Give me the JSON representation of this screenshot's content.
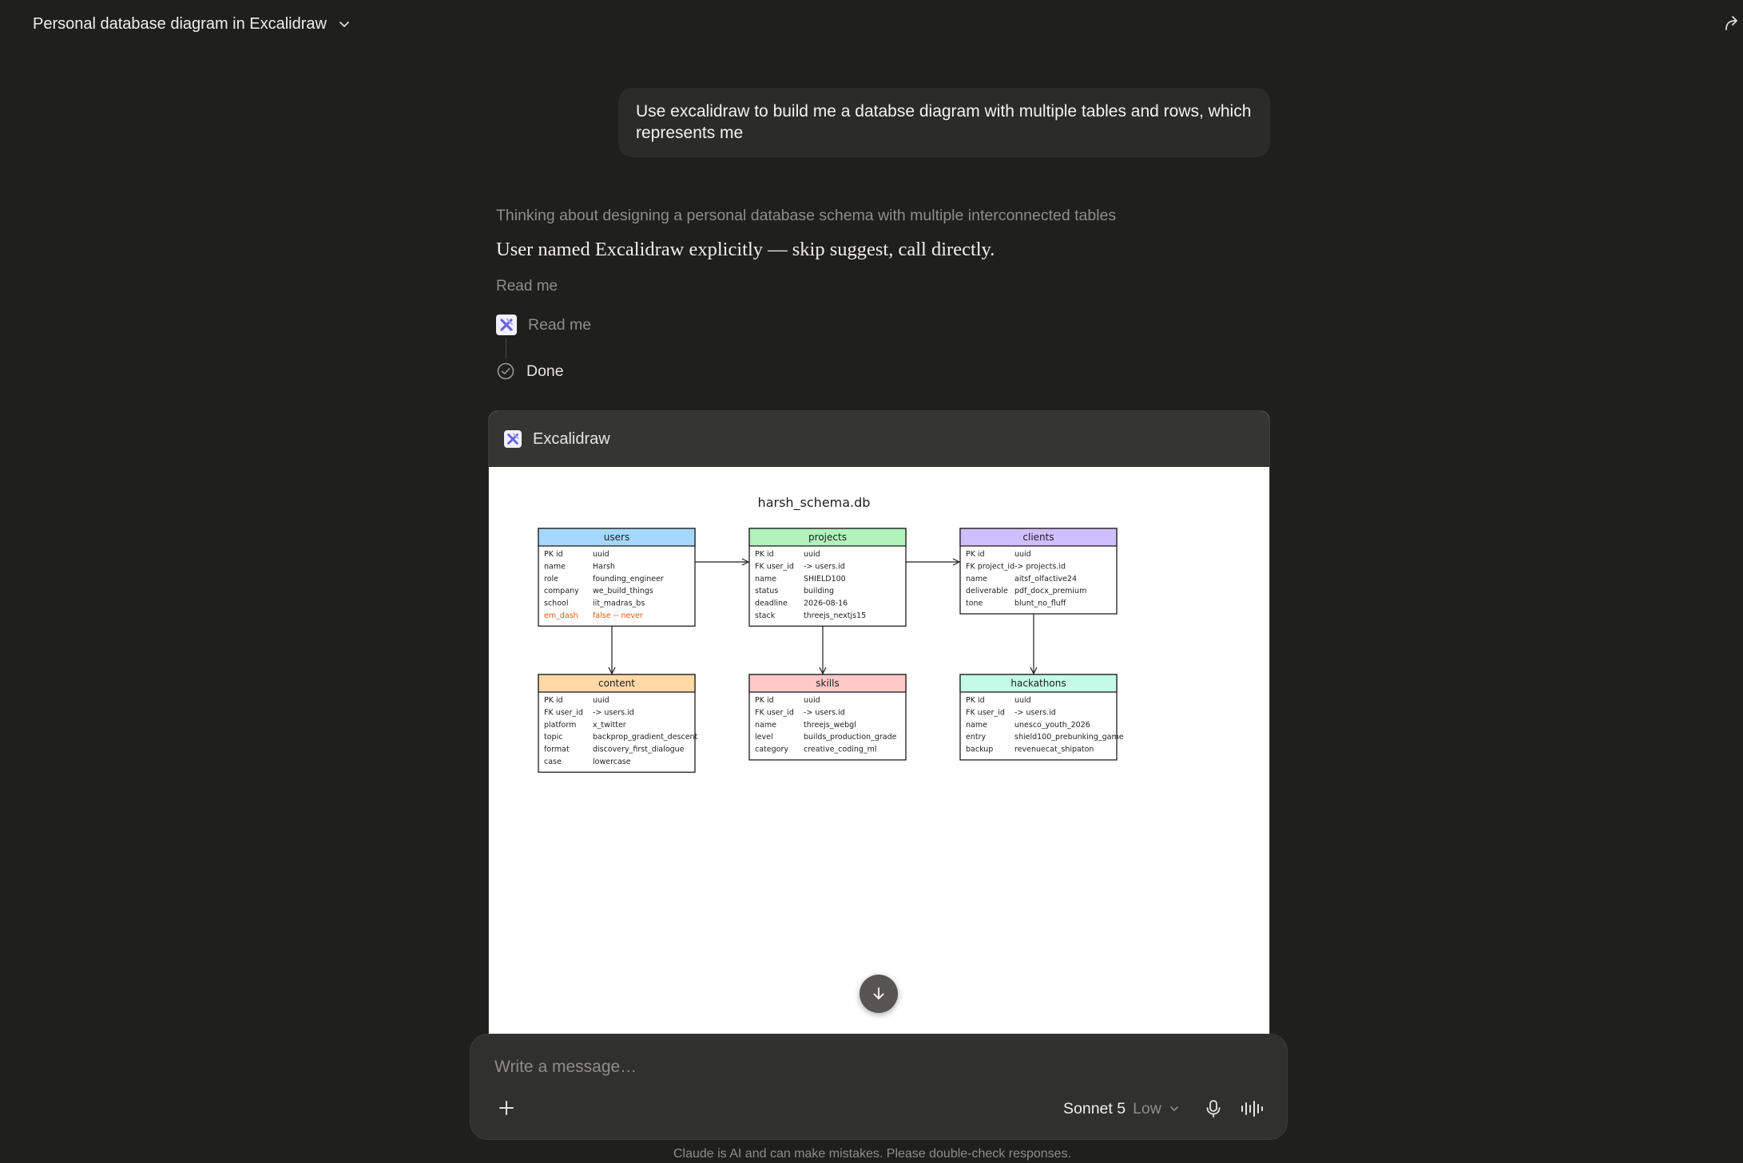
{
  "header": {
    "conversation_title": "Personal database diagram in Excalidraw",
    "chevron_icon": "chevron-down-icon",
    "share_icon": "share-arrow-icon"
  },
  "user_message": {
    "text": "Use excalidraw to build me a databse diagram with multiple tables and rows, which represents me"
  },
  "assistant": {
    "thinking_summary": "Thinking about designing a personal database schema with multiple interconnected tables",
    "text": "User named Excalidraw explicitly — skip suggest, call directly.",
    "read_me_link": "Read me",
    "steps": [
      {
        "label": "Read me",
        "icon": "excalidraw-icon"
      },
      {
        "label": "Done",
        "icon": "check-circle-icon"
      }
    ]
  },
  "artifact": {
    "title": "Excalidraw",
    "diagram": {
      "title": "harsh_schema.db",
      "tables": [
        {
          "name": "users",
          "color": "#a5d8ff",
          "rows": [
            [
              "PK id",
              "uuid"
            ],
            [
              "name",
              "Harsh"
            ],
            [
              "role",
              "founding_engineer"
            ],
            [
              "company",
              "we_build_things"
            ],
            [
              "school",
              "iit_madras_bs"
            ],
            [
              "em_dash",
              "false -- never"
            ]
          ],
          "highlight_last": true
        },
        {
          "name": "projects",
          "color": "#b2f2bb",
          "rows": [
            [
              "PK id",
              "uuid"
            ],
            [
              "FK user_id",
              "-> users.id"
            ],
            [
              "name",
              "SHIELD100"
            ],
            [
              "status",
              "building"
            ],
            [
              "deadline",
              "2026-08-16"
            ],
            [
              "stack",
              "threejs_nextjs15"
            ]
          ]
        },
        {
          "name": "clients",
          "color": "#d0bfff",
          "rows": [
            [
              "PK id",
              "uuid"
            ],
            [
              "FK project_id",
              "-> projects.id"
            ],
            [
              "name",
              "aitsf_olfactive24"
            ],
            [
              "deliverable",
              "pdf_docx_premium"
            ],
            [
              "tone",
              "blunt_no_fluff"
            ]
          ]
        },
        {
          "name": "content",
          "color": "#ffd8a8",
          "rows": [
            [
              "PK id",
              "uuid"
            ],
            [
              "FK user_id",
              "-> users.id"
            ],
            [
              "platform",
              "x_twitter"
            ],
            [
              "topic",
              "backprop_gradient_descent"
            ],
            [
              "format",
              "discovery_first_dialogue"
            ],
            [
              "case",
              "lowercase"
            ]
          ]
        },
        {
          "name": "skills",
          "color": "#ffc9c9",
          "rows": [
            [
              "PK id",
              "uuid"
            ],
            [
              "FK user_id",
              "-> users.id"
            ],
            [
              "name",
              "threejs_webgl"
            ],
            [
              "level",
              "builds_production_grade"
            ],
            [
              "category",
              "creative_coding_ml"
            ]
          ]
        },
        {
          "name": "hackathons",
          "color": "#c3fae8",
          "rows": [
            [
              "PK id",
              "uuid"
            ],
            [
              "FK user_id",
              "-> users.id"
            ],
            [
              "name",
              "unesco_youth_2026"
            ],
            [
              "entry",
              "shield100_prebunking_game"
            ],
            [
              "backup",
              "revenuecat_shipaton"
            ]
          ]
        }
      ],
      "highlight_color": "#e8590c",
      "relations": [
        {
          "from": "users",
          "to": "projects"
        },
        {
          "from": "projects",
          "to": "clients"
        },
        {
          "from": "users",
          "to": "content"
        },
        {
          "from": "projects",
          "to": "skills"
        },
        {
          "from": "clients",
          "to": "hackathons"
        }
      ]
    }
  },
  "composer": {
    "placeholder": "Write a message…",
    "model": "Sonnet 5",
    "effort": "Low",
    "plus_icon": "plus-icon",
    "mic_icon": "microphone-icon",
    "voice_icon": "voice-waveform-icon"
  },
  "scroll_button_icon": "arrow-down-icon",
  "disclaimer": "Claude is AI and can make mistakes. Please double-check responses.",
  "colors": {
    "background": "#1f1f1e",
    "bubble": "#2b2b29",
    "composer": "#30302e",
    "muted_text": "#8f8d87"
  }
}
